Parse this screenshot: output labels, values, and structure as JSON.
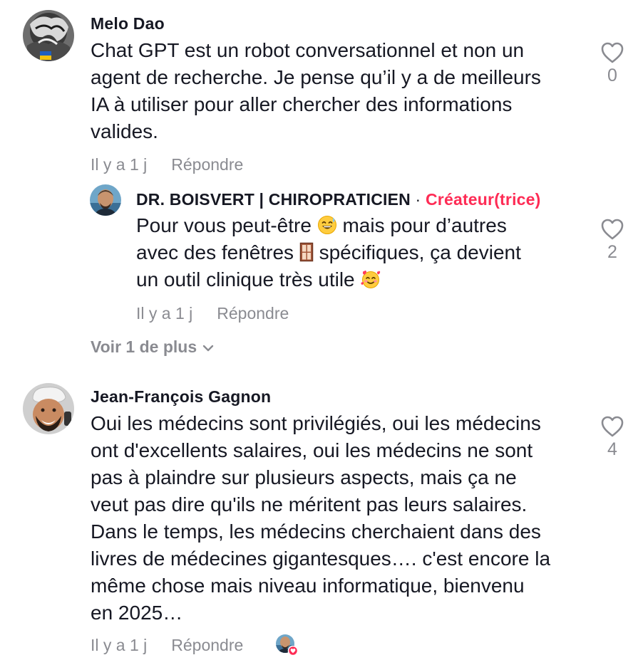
{
  "comments": [
    {
      "author": "Melo Dao",
      "lines": [
        "Chat GPT est un robot conversationnel et non un",
        "agent de recherche. Je pense qu’il y a de meilleurs",
        "IA à utiliser pour aller chercher des informations",
        "valides."
      ],
      "time": "Il y a 1 j",
      "reply_label": "Répondre",
      "likes": "0"
    },
    {
      "author": "DR. BOISVERT | CHIROPRATICIEN",
      "separator": "·",
      "creator_badge": "Créateur(trice)",
      "line1_a": "Pour vous peut-être ",
      "line1_b": " mais pour d’autres",
      "line2_a": "avec des fenêtres ",
      "line2_b": " spécifiques, ça devient",
      "line3_a": "un outil clinique très utile ",
      "time": "Il y a 1 j",
      "reply_label": "Répondre",
      "likes": "2"
    },
    {
      "author": "Jean-François Gagnon",
      "lines": [
        "Oui les médecins sont privilégiés, oui les médecins",
        "ont d'excellents salaires, oui les médecins ne sont",
        "pas à plaindre sur plusieurs aspects, mais ça ne",
        "veut pas dire qu'ils ne méritent pas leurs salaires.",
        "Dans le temps, les médecins cherchaient dans des",
        "livres de médecines gigantesques…. c'est encore la",
        "même chose mais niveau informatique, bienvenu",
        "en 2025…"
      ],
      "time": "Il y a 1 j",
      "reply_label": "Répondre",
      "likes": "4"
    }
  ],
  "view_more_label": "Voir 1 de plus",
  "icons": {
    "like": "heart-outline-icon",
    "chevron": "chevron-down-icon",
    "creator_liked": "creator-liked-avatar-icon"
  },
  "colors": {
    "text": "#161823",
    "muted": "#8a8b91",
    "creator": "#fe2c55"
  }
}
